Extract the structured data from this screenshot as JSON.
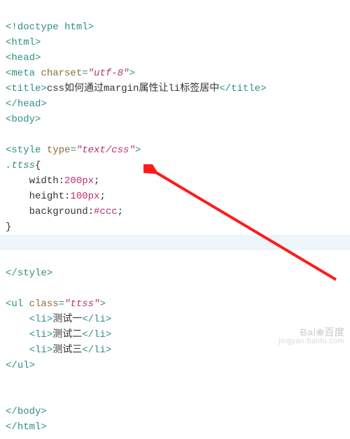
{
  "lines": {
    "l1": {
      "open": "<!",
      "name": "doctype html",
      "close": ">"
    },
    "l2": {
      "open": "<",
      "name": "html",
      "close": ">"
    },
    "l3": {
      "open": "<",
      "name": "head",
      "close": ">"
    },
    "l4": {
      "open": "<",
      "name": "meta",
      "attr": "charset",
      "val": "\"utf-8\"",
      "close": ">"
    },
    "l5": {
      "open": "<",
      "name": "title",
      "close": ">",
      "text": "css如何通过margin属性让li标签居中",
      "open2": "</",
      "name2": "title",
      "close2": ">"
    },
    "l6": {
      "open": "</",
      "name": "head",
      "close": ">"
    },
    "l7": {
      "open": "<",
      "name": "body",
      "close": ">"
    },
    "l9": {
      "open": "<",
      "name": "style",
      "attr": "type",
      "val": "\"text/css\"",
      "close": ">"
    },
    "l10": {
      "sel": ".ttss",
      "brace": "{"
    },
    "l11": {
      "pad": "    ",
      "prop": "width:",
      "val": "200px",
      "semi": ";"
    },
    "l12": {
      "pad": "    ",
      "prop": "height:",
      "val": "100px",
      "semi": ";"
    },
    "l13": {
      "pad": "    ",
      "prop": "background:",
      "val": "#ccc",
      "semi": ";"
    },
    "l14": {
      "brace": "}"
    },
    "l16": {
      "open": "</",
      "name": "style",
      "close": ">"
    },
    "l18": {
      "open": "<",
      "name": "ul",
      "attr": "class",
      "val": "\"ttss\"",
      "close": ">"
    },
    "l19": {
      "pad": "    ",
      "open": "<",
      "name": "li",
      "close": ">",
      "text": "测试一",
      "open2": "</",
      "name2": "li",
      "close2": ">"
    },
    "l20": {
      "pad": "    ",
      "open": "<",
      "name": "li",
      "close": ">",
      "text": "测试二",
      "open2": "</",
      "name2": "li",
      "close2": ">"
    },
    "l21": {
      "pad": "    ",
      "open": "<",
      "name": "li",
      "close": ">",
      "text": "测试三",
      "open2": "</",
      "name2": "li",
      "close2": ">"
    },
    "l22": {
      "open": "</",
      "name": "ul",
      "close": ">"
    },
    "l25": {
      "open": "</",
      "name": "body",
      "close": ">"
    },
    "l26": {
      "open": "</",
      "name": "html",
      "close": ">"
    }
  },
  "watermark": {
    "brand": "Bai❀百度",
    "sub": "jingyan.baidu.com"
  }
}
